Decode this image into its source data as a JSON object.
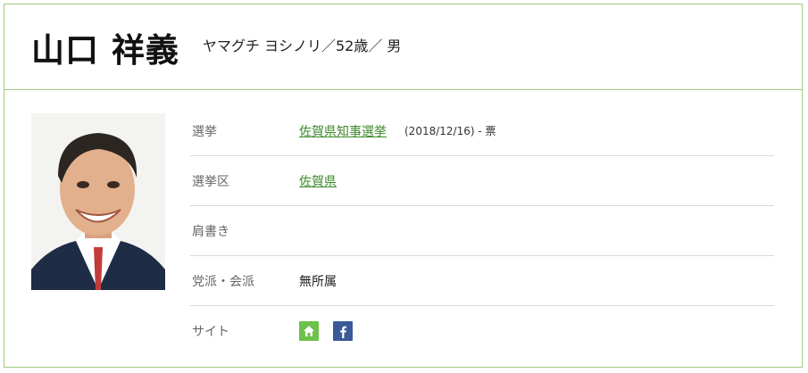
{
  "header": {
    "name": "山口 祥義",
    "reading_age_gender": "ヤマグチ ヨシノリ／52歳／ 男"
  },
  "profile": {
    "rows": [
      {
        "label": "選挙",
        "link": "佐賀県知事選挙",
        "meta": "(2018/12/16) - 票"
      },
      {
        "label": "選挙区",
        "link": "佐賀県"
      },
      {
        "label": "肩書き",
        "value": ""
      },
      {
        "label": "党派・会派",
        "value": "無所属"
      },
      {
        "label": "サイト"
      }
    ]
  },
  "icons": {
    "home": "home-icon",
    "facebook": "facebook-icon"
  },
  "colors": {
    "border": "#9ccd7f",
    "link": "#3e8a2b",
    "home_icon_bg": "#6cc24a",
    "facebook_icon_bg": "#3b5998"
  }
}
